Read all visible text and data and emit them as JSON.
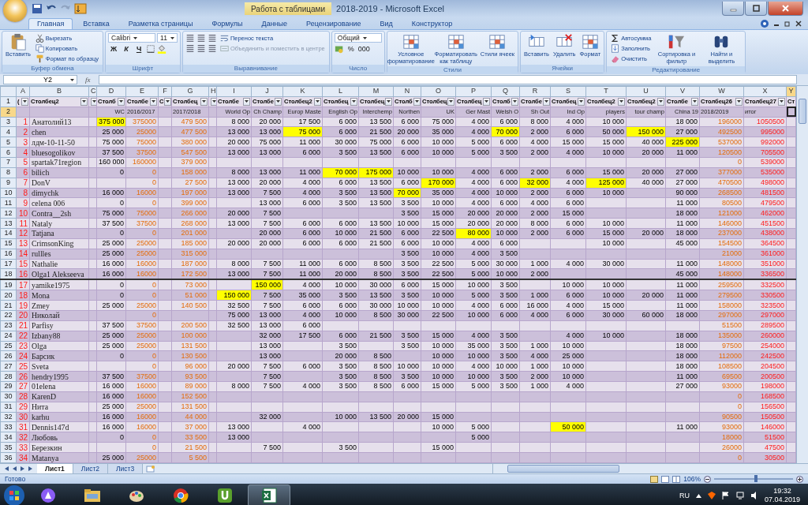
{
  "window": {
    "context_label": "Работа с таблицами",
    "title": "2018-2019 - Microsoft Excel"
  },
  "ribbon": {
    "tabs": [
      {
        "label": "Главная",
        "selected": true
      },
      {
        "label": "Вставка",
        "selected": false
      },
      {
        "label": "Разметка страницы",
        "selected": false
      },
      {
        "label": "Формулы",
        "selected": false
      },
      {
        "label": "Данные",
        "selected": false
      },
      {
        "label": "Рецензирование",
        "selected": false
      },
      {
        "label": "Вид",
        "selected": false
      },
      {
        "label": "Конструктор",
        "selected": false
      }
    ],
    "groups": [
      {
        "title": "Буфер обмена",
        "items": [
          {
            "kind": "large",
            "label": "Вставить"
          },
          {
            "kind": "stack",
            "items": [
              {
                "kind": "small",
                "label": "Вырезать",
                "disabled": false
              },
              {
                "kind": "small",
                "label": "Копировать",
                "disabled": false
              },
              {
                "kind": "small",
                "label": "Формат по образцу",
                "disabled": false
              }
            ]
          }
        ]
      },
      {
        "title": "Шрифт",
        "items": [
          {
            "kind": "stack",
            "items": [
              {
                "kind": "row",
                "items": [
                  {
                    "kind": "dropdown",
                    "label": "Calibri"
                  },
                  {
                    "kind": "dropdown",
                    "label": "11"
                  }
                ]
              },
              {
                "kind": "row",
                "items": [
                  {
                    "kind": "glyph",
                    "label": "Ж"
                  },
                  {
                    "kind": "glyph",
                    "label": "К"
                  },
                  {
                    "kind": "glyph",
                    "label": "Ч"
                  },
                  {
                    "kind": "tool"
                  },
                  {
                    "kind": "tool"
                  }
                ]
              }
            ]
          }
        ]
      },
      {
        "title": "Выравнивание",
        "items": [
          {
            "kind": "stack",
            "items": [
              {
                "kind": "row",
                "items": [
                  {
                    "kind": "tool"
                  },
                  {
                    "kind": "tool"
                  },
                  {
                    "kind": "tool"
                  },
                  {
                    "kind": "small",
                    "label": "Перенос текста",
                    "disabled": false
                  }
                ]
              },
              {
                "kind": "row",
                "items": [
                  {
                    "kind": "tool"
                  },
                  {
                    "kind": "tool"
                  },
                  {
                    "kind": "tool"
                  },
                  {
                    "kind": "small",
                    "label": "Объединить и поместить в центре",
                    "disabled": true
                  }
                ]
              }
            ]
          }
        ]
      },
      {
        "title": "Число",
        "items": [
          {
            "kind": "stack",
            "items": [
              {
                "kind": "dropdown",
                "label": "Общий"
              },
              {
                "kind": "row",
                "items": [
                  {
                    "kind": "tool"
                  },
                  {
                    "kind": "glyph",
                    "label": "%"
                  },
                  {
                    "kind": "glyph",
                    "label": "000"
                  }
                ]
              }
            ]
          }
        ]
      },
      {
        "title": "Стили",
        "items": [
          {
            "kind": "large",
            "label": "Условное форматирование"
          },
          {
            "kind": "large",
            "label": "Форматировать как таблицу"
          },
          {
            "kind": "large",
            "label": "Стили ячеек"
          }
        ]
      },
      {
        "title": "Ячейки",
        "items": [
          {
            "kind": "large",
            "label": "Вставить"
          },
          {
            "kind": "large",
            "label": "Удалить"
          },
          {
            "kind": "large",
            "label": "Формат"
          }
        ]
      },
      {
        "title": "Редактирование",
        "items": [
          {
            "kind": "stack",
            "items": [
              {
                "kind": "small",
                "label": "Автосумма",
                "disabled": false
              },
              {
                "kind": "small",
                "label": "Заполнить",
                "disabled": false
              },
              {
                "kind": "small",
                "label": "Очистить",
                "disabled": false
              }
            ]
          },
          {
            "kind": "large",
            "label": "Сортировка и фильтр"
          },
          {
            "kind": "large",
            "label": "Найти и выделить"
          }
        ]
      }
    ]
  },
  "formula_bar": {
    "name_box": "Y2",
    "fx": "fx"
  },
  "sheet": {
    "header_row_number": "1",
    "subheader_row_number": "2",
    "subheader_row_selected": true,
    "columns": [
      {
        "letter": "A",
        "header": "(",
        "kind": "index",
        "filter": true,
        "selected": false
      },
      {
        "letter": "B",
        "header": "Столбец2",
        "kind": "name",
        "filter": true,
        "selected": false
      },
      {
        "letter": "C",
        "kind": "narrow",
        "filter": true,
        "selected": false
      },
      {
        "letter": "D",
        "header": "Столб",
        "subheader": "WC",
        "kind": "number",
        "filter": true,
        "selected": false
      },
      {
        "letter": "E",
        "header": "Столбе",
        "subheader": "2016/2017",
        "kind": "orange",
        "filter": true,
        "selected": false
      },
      {
        "letter": "F",
        "header": "С",
        "kind": "narrow",
        "filter": true,
        "selected": false
      },
      {
        "letter": "G",
        "header": "Столбец",
        "subheader": "2017/2018",
        "kind": "orange",
        "filter": true,
        "selected": false
      },
      {
        "letter": "H",
        "kind": "narrow",
        "filter": true,
        "selected": false
      },
      {
        "letter": "I",
        "header": "Столбе",
        "subheader": "World Op",
        "kind": "number",
        "filter": true,
        "selected": false
      },
      {
        "letter": "J",
        "header": "Столбе",
        "subheader": "Ch Champ",
        "kind": "number",
        "filter": true,
        "selected": false
      },
      {
        "letter": "K",
        "header": "Столбец2",
        "subheader": "Europ Maste",
        "kind": "number",
        "filter": true,
        "selected": false
      },
      {
        "letter": "L",
        "header": "Столбец",
        "subheader": "English Op",
        "kind": "number",
        "filter": true,
        "selected": false
      },
      {
        "letter": "M",
        "header": "Столбец",
        "subheader": "Interchemp",
        "kind": "number",
        "filter": true,
        "selected": false
      },
      {
        "letter": "N",
        "header": "Столб",
        "subheader": "Northen",
        "kind": "number",
        "filter": true,
        "selected": false
      },
      {
        "letter": "O",
        "header": "Столбец",
        "subheader": "UK",
        "kind": "number",
        "filter": true,
        "selected": false
      },
      {
        "letter": "P",
        "header": "Столбец",
        "subheader": "Ger  Mast",
        "kind": "number",
        "filter": true,
        "selected": false
      },
      {
        "letter": "Q",
        "header": "Столб",
        "subheader": "Welsh O",
        "kind": "number",
        "filter": true,
        "selected": false
      },
      {
        "letter": "R",
        "header": "Столбе",
        "subheader": "Sh Out",
        "kind": "number",
        "filter": true,
        "selected": false
      },
      {
        "letter": "S",
        "header": "Столбец",
        "subheader": "Ind Op",
        "kind": "number",
        "filter": true,
        "selected": false
      },
      {
        "letter": "T",
        "header": "Столбец2",
        "subheader": "players",
        "kind": "number",
        "filter": true,
        "selected": false
      },
      {
        "letter": "U",
        "header": "Столбец2",
        "subheader": "tour champ",
        "kind": "number",
        "filter": true,
        "selected": false
      },
      {
        "letter": "V",
        "header": "Столбе",
        "subheader": "China 19",
        "kind": "number",
        "filter": true,
        "selected": false
      },
      {
        "letter": "W",
        "header": "Столбец26",
        "subheader": "2018/2019",
        "kind": "orange",
        "filter": true,
        "selected": false
      },
      {
        "letter": "X",
        "header": "Столбец27",
        "subheader": "итог",
        "kind": "red",
        "filter": true,
        "selected": false
      },
      {
        "letter": "Y",
        "header": "Ст",
        "kind": "narrow",
        "filter": false,
        "selected": true
      }
    ],
    "rows": [
      {
        "row_number": "3",
        "cells": [
          "1",
          "Анатолий13",
          null,
          {
            "value": "375 000",
            "highlighted": true
          },
          "375000",
          null,
          "479 500",
          null,
          "8 000",
          "20 000",
          "17 500",
          "6 000",
          "13 500",
          "6 000",
          "75 000",
          "4 000",
          "6 000",
          "8 000",
          "4 000",
          "10 000",
          null,
          "18 000",
          "196000",
          "1050500"
        ]
      },
      {
        "row_number": "4",
        "cells": [
          "2",
          "chen",
          null,
          "25 000",
          "25000",
          null,
          "477 500",
          null,
          "13 000",
          "13 000",
          {
            "value": "75 000",
            "highlighted": true
          },
          "6 000",
          "21 500",
          "20 000",
          "35 000",
          "4 000",
          {
            "value": "70 000",
            "highlighted": true
          },
          "2 000",
          "6 000",
          "50 000",
          {
            "value": "150 000",
            "highlighted": true
          },
          "27 000",
          "492500",
          "995000"
        ]
      },
      {
        "row_number": "5",
        "cells": [
          "3",
          "лдм-10-11-50",
          null,
          "75 000",
          "75000",
          null,
          "380 000",
          null,
          "20 000",
          "75 000",
          "11 000",
          "30 000",
          "75 000",
          "6 000",
          "10 000",
          "5 000",
          "6 000",
          "4 000",
          "15 000",
          "15 000",
          "40 000",
          {
            "value": "225 000",
            "highlighted": true
          },
          "537000",
          "992000"
        ]
      },
      {
        "row_number": "6",
        "cells": [
          "4",
          "bluesogolikov",
          null,
          "37 500",
          "37500",
          null,
          "547 500",
          null,
          "13 000",
          "13 000",
          "6 000",
          "3 500",
          "13 500",
          "6 000",
          "10 000",
          "5 000",
          "3 500",
          "2 000",
          "4 000",
          "10 000",
          "20 000",
          "11 000",
          "120500",
          "705500"
        ]
      },
      {
        "row_number": "7",
        "cells": [
          "5",
          "spartak71region",
          null,
          "160 000",
          "160000",
          null,
          "379 000",
          null,
          null,
          null,
          null,
          null,
          null,
          null,
          null,
          null,
          null,
          null,
          null,
          null,
          null,
          null,
          "0",
          "539000"
        ]
      },
      {
        "row_number": "8",
        "cells": [
          "6",
          "bilich",
          null,
          "0",
          "0",
          null,
          "158 000",
          null,
          "8 000",
          "13 000",
          "11 000",
          {
            "value": "70 000",
            "highlighted": true
          },
          {
            "value": "175 000",
            "highlighted": true
          },
          "10 000",
          "10 000",
          "4 000",
          "6 000",
          "2 000",
          "6 000",
          "15 000",
          "20 000",
          "27 000",
          "377000",
          "535000"
        ]
      },
      {
        "row_number": "9",
        "cells": [
          "7",
          "DonV",
          null,
          null,
          "0",
          null,
          "27 500",
          null,
          "13 000",
          "20 000",
          "4 000",
          "6 000",
          "13 500",
          "6 000",
          {
            "value": "170 000",
            "highlighted": true
          },
          "4 000",
          "6 000",
          {
            "value": "32 000",
            "highlighted": true
          },
          "4 000",
          {
            "value": "125 000",
            "highlighted": true
          },
          "40 000",
          "27 000",
          "470500",
          "498000"
        ]
      },
      {
        "row_number": "10",
        "cells": [
          "8",
          "dimychk",
          null,
          "16 000",
          "16000",
          null,
          "197 000",
          null,
          "13 000",
          "7 500",
          "4 000",
          "3 500",
          "13 500",
          {
            "value": "70 000",
            "highlighted": true
          },
          "35 000",
          "4 000",
          "10 000",
          "2 000",
          "6 000",
          "10 000",
          null,
          "90 000",
          "268500",
          "481500"
        ]
      },
      {
        "row_number": "11",
        "cells": [
          "9",
          "celena 006",
          null,
          "0",
          "0",
          null,
          "399 000",
          null,
          null,
          "13 000",
          "6 000",
          "3 500",
          "13 500",
          "3 500",
          "10 000",
          "4 000",
          "6 000",
          "4 000",
          "6 000",
          null,
          null,
          "11 000",
          "80500",
          "479500"
        ]
      },
      {
        "row_number": "12",
        "cells": [
          "10",
          "Contra__2sh",
          null,
          "75 000",
          "75000",
          null,
          "266 000",
          null,
          "20 000",
          "7 500",
          null,
          null,
          null,
          "3 500",
          "15 000",
          "20 000",
          "20 000",
          "2 000",
          "15 000",
          null,
          null,
          "18 000",
          "121000",
          "462000"
        ]
      },
      {
        "row_number": "13",
        "cells": [
          "11",
          "Nataly",
          null,
          "37 500",
          "37500",
          null,
          "268 000",
          null,
          "13 000",
          "7 500",
          "6 000",
          "6 000",
          "13 500",
          "10 000",
          "15 000",
          "20 000",
          "20 000",
          "8 000",
          "6 000",
          "10 000",
          null,
          "11 000",
          "146000",
          "451500"
        ]
      },
      {
        "row_number": "14",
        "cells": [
          "12",
          "Tatjana",
          null,
          "0",
          "0",
          null,
          "201 000",
          null,
          null,
          "20 000",
          "6 000",
          "10 000",
          "21 500",
          "6 000",
          "22 500",
          {
            "value": "80 000",
            "highlighted": true
          },
          "10 000",
          "2 000",
          "6 000",
          "15 000",
          "20 000",
          "18 000",
          "237000",
          "438000"
        ]
      },
      {
        "row_number": "15",
        "cells": [
          "13",
          "CrimsonKing",
          null,
          "25 000",
          "25000",
          null,
          "185 000",
          null,
          "20 000",
          "20 000",
          "6 000",
          "6 000",
          "21 500",
          "6 000",
          "10 000",
          "4 000",
          "6 000",
          null,
          null,
          "10 000",
          null,
          "45 000",
          "154500",
          "364500"
        ]
      },
      {
        "row_number": "16",
        "cells": [
          "14",
          "rullles",
          null,
          "25 000",
          "25000",
          null,
          "315 000",
          null,
          null,
          null,
          null,
          null,
          null,
          "3 500",
          "10 000",
          "4 000",
          "3 500",
          null,
          null,
          null,
          null,
          null,
          "21000",
          "361000"
        ]
      },
      {
        "row_number": "17",
        "cells": [
          "15",
          "Nathalie",
          null,
          "16 000",
          "16000",
          null,
          "187 000",
          null,
          "8 000",
          "7 500",
          "11 000",
          "6 000",
          "8 500",
          "3 500",
          "22 500",
          "5 000",
          "30 000",
          "1 000",
          "4 000",
          "30 000",
          null,
          "11 000",
          "148000",
          "351000"
        ]
      },
      {
        "row_number": "18",
        "cells": [
          "16",
          "Olga1 Alekseeva",
          null,
          "16 000",
          "16000",
          null,
          "172 500",
          null,
          "13 000",
          "7 500",
          "11 000",
          "20 000",
          "8 500",
          "3 500",
          "22 500",
          "5 000",
          "10 000",
          "2 000",
          null,
          null,
          null,
          "45 000",
          "148000",
          "336500"
        ]
      },
      {
        "row_number": "19",
        "border_top": true,
        "cells": [
          "17",
          "yamike1975",
          null,
          "0",
          "0",
          null,
          "73 000",
          null,
          null,
          {
            "value": "150 000",
            "highlighted": true
          },
          "4 000",
          "10 000",
          "30 000",
          "6 000",
          "15 000",
          "10 000",
          "3 500",
          null,
          "10 000",
          "10 000",
          null,
          "11 000",
          "259500",
          "332500"
        ]
      },
      {
        "row_number": "20",
        "cells": [
          "18",
          "Mona",
          null,
          "0",
          "0",
          null,
          "51 000",
          null,
          {
            "value": "150 000",
            "highlighted": true
          },
          "7 500",
          "35 000",
          "3 500",
          "13 500",
          "3 500",
          "10 000",
          "5 000",
          "3 500",
          "1 000",
          "6 000",
          "10 000",
          "20 000",
          "11 000",
          "279500",
          "330500"
        ]
      },
      {
        "row_number": "21",
        "cells": [
          "19",
          "Zmey",
          null,
          "25 000",
          "25000",
          null,
          "140 500",
          null,
          "32 500",
          "7 500",
          "6 000",
          "6 000",
          "30 000",
          "10 000",
          "10 000",
          "4 000",
          "6 000",
          "16 000",
          "4 000",
          "15 000",
          null,
          "11 000",
          "158000",
          "323500"
        ]
      },
      {
        "row_number": "22",
        "cells": [
          "20",
          "Николай",
          null,
          null,
          "0",
          null,
          null,
          null,
          "75 000",
          "13 000",
          "4 000",
          "10 000",
          "8 500",
          "30 000",
          "22 500",
          "10 000",
          "6 000",
          "4 000",
          "6 000",
          "30 000",
          "60 000",
          "18 000",
          "297000",
          "297000"
        ]
      },
      {
        "row_number": "23",
        "cells": [
          "21",
          "Parfisy",
          null,
          "37 500",
          "37500",
          null,
          "200 500",
          null,
          "32 500",
          "13 000",
          "6 000",
          null,
          null,
          null,
          null,
          null,
          null,
          null,
          null,
          null,
          null,
          null,
          "51500",
          "289500"
        ]
      },
      {
        "row_number": "24",
        "cells": [
          "22",
          "Izbany88",
          null,
          "25 000",
          "25000",
          null,
          "100 000",
          null,
          null,
          "32 000",
          "17 500",
          "6 000",
          "21 500",
          "3 500",
          "15 000",
          "4 000",
          "3 500",
          null,
          "4 000",
          "10 000",
          null,
          "18 000",
          "135000",
          "260000"
        ]
      },
      {
        "row_number": "25",
        "cells": [
          "23",
          "Olga",
          null,
          "25 000",
          "25000",
          null,
          "131 500",
          null,
          null,
          "13 000",
          null,
          "3 500",
          null,
          "3 500",
          "10 000",
          "35 000",
          "3 500",
          "1 000",
          "10 000",
          null,
          null,
          "18 000",
          "97500",
          "254000"
        ]
      },
      {
        "row_number": "26",
        "cells": [
          "24",
          "Барсик",
          null,
          "0",
          "0",
          null,
          "130 500",
          null,
          null,
          "13 000",
          null,
          "20 000",
          "8 500",
          null,
          "10 000",
          "10 000",
          "3 500",
          "4 000",
          "25 000",
          null,
          null,
          "18 000",
          "112000",
          "242500"
        ]
      },
      {
        "row_number": "27",
        "cells": [
          "25",
          "Sveta",
          null,
          null,
          "0",
          null,
          "96 000",
          null,
          "20 000",
          "7 500",
          "6 000",
          "3 500",
          "8 500",
          "10 000",
          "10 000",
          "4 000",
          "10 000",
          "1 000",
          "10 000",
          null,
          null,
          "18 000",
          "108500",
          "204500"
        ]
      },
      {
        "row_number": "28",
        "cells": [
          "26",
          "hendry1995",
          null,
          "37 500",
          "37500",
          null,
          "93 500",
          null,
          null,
          "7 500",
          null,
          "3 500",
          "8 500",
          "3 500",
          "10 000",
          "10 000",
          "3 500",
          "2 000",
          "10 000",
          null,
          null,
          "11 000",
          "69500",
          "200500"
        ]
      },
      {
        "row_number": "29",
        "cells": [
          "27",
          "01elena",
          null,
          "16 000",
          "16000",
          null,
          "89 000",
          null,
          "8 000",
          "7 500",
          "4 000",
          "3 500",
          "8 500",
          "6 000",
          "15 000",
          "5 000",
          "3 500",
          "1 000",
          "4 000",
          null,
          null,
          "27 000",
          "93000",
          "198000"
        ]
      },
      {
        "row_number": "30",
        "cells": [
          "28",
          "KarenD",
          null,
          "16 000",
          "16000",
          null,
          "152 500",
          null,
          null,
          null,
          null,
          null,
          null,
          null,
          null,
          null,
          null,
          null,
          null,
          null,
          null,
          null,
          "0",
          "168500"
        ]
      },
      {
        "row_number": "31",
        "cells": [
          "29",
          "Нита",
          null,
          "25 000",
          "25000",
          null,
          "131 500",
          null,
          null,
          null,
          null,
          null,
          null,
          null,
          null,
          null,
          null,
          null,
          null,
          null,
          null,
          null,
          "0",
          "156500"
        ]
      },
      {
        "row_number": "32",
        "cells": [
          "30",
          "karhu",
          null,
          "16 000",
          "16000",
          null,
          "44 000",
          null,
          null,
          "32 000",
          null,
          "10 000",
          "13 500",
          "20 000",
          "15 000",
          null,
          null,
          null,
          null,
          null,
          null,
          null,
          "90500",
          "150500"
        ]
      },
      {
        "row_number": "33",
        "cells": [
          "31",
          "Dennis147d",
          null,
          "16 000",
          "16000",
          null,
          "37 000",
          null,
          "13 000",
          null,
          "4 000",
          null,
          null,
          null,
          "10 000",
          "5 000",
          null,
          null,
          {
            "value": "50 000",
            "highlighted": true
          },
          null,
          null,
          "11 000",
          "93000",
          "146000"
        ]
      },
      {
        "row_number": "34",
        "cells": [
          "32",
          "Любовь",
          null,
          "0",
          "0",
          null,
          "33 500",
          null,
          "13 000",
          null,
          null,
          null,
          null,
          null,
          null,
          "5 000",
          null,
          null,
          null,
          null,
          null,
          null,
          "18000",
          "51500"
        ]
      },
      {
        "row_number": "35",
        "cells": [
          "33",
          "Березкин",
          null,
          null,
          "0",
          null,
          "21 500",
          null,
          null,
          "7 500",
          null,
          "3 500",
          null,
          null,
          "15 000",
          null,
          null,
          null,
          null,
          null,
          null,
          null,
          "26000",
          "47500"
        ]
      },
      {
        "row_number": "36",
        "cells": [
          "34",
          "Matanya",
          null,
          "25 000",
          "25000",
          null,
          "5 500",
          null,
          null,
          null,
          null,
          null,
          null,
          null,
          null,
          null,
          null,
          null,
          null,
          null,
          null,
          null,
          "0",
          "30500"
        ]
      }
    ]
  },
  "sheet_tabs": [
    {
      "label": "Лист1",
      "selected": true
    },
    {
      "label": "Лист2",
      "selected": false
    },
    {
      "label": "Лист3",
      "selected": false
    }
  ],
  "status_bar": {
    "text": "Готово",
    "zoom": "106%",
    "level": 0.53
  },
  "taskbar": {
    "apps": [
      {
        "kind": "assistant",
        "selected": false
      },
      {
        "kind": "folder",
        "selected": false
      },
      {
        "kind": "paint",
        "selected": false
      },
      {
        "kind": "browser",
        "selected": false
      },
      {
        "kind": "download",
        "selected": false
      },
      {
        "kind": "spreadsheet",
        "selected": true
      }
    ],
    "language": "RU",
    "time": "19:32",
    "date": "07.04.2019"
  }
}
